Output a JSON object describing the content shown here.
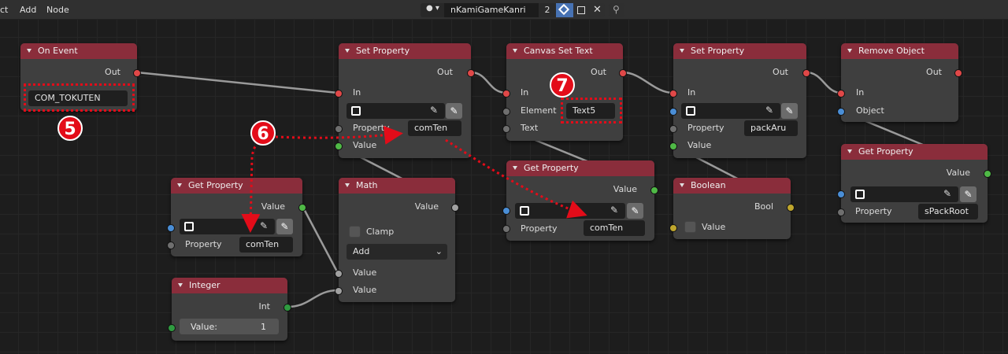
{
  "header": {
    "menu": [
      "ct",
      "Add",
      "Node"
    ],
    "tree_name": "nKamiGameKanri",
    "users": "2"
  },
  "nodes": {
    "on_event": {
      "title": "On Event",
      "out": "Out",
      "event": "COM_TOKUTEN"
    },
    "set_prop1": {
      "title": "Set Property",
      "out": "Out",
      "in": "In",
      "property_label": "Property",
      "property": "comTen",
      "value": "Value"
    },
    "canvas_text": {
      "title": "Canvas Set Text",
      "out": "Out",
      "in": "In",
      "element_label": "Element",
      "element": "Text5",
      "text": "Text"
    },
    "set_prop2": {
      "title": "Set Property",
      "out": "Out",
      "in": "In",
      "property_label": "Property",
      "property": "packAru",
      "value": "Value"
    },
    "remove_obj": {
      "title": "Remove Object",
      "out": "Out",
      "in": "In",
      "object": "Object"
    },
    "get_prop_right": {
      "title": "Get Property",
      "value": "Value",
      "property_label": "Property",
      "property": "sPackRoot"
    },
    "get_prop_left": {
      "title": "Get Property",
      "value": "Value",
      "property_label": "Property",
      "property": "comTen"
    },
    "math": {
      "title": "Math",
      "value": "Value",
      "clamp": "Clamp",
      "op": "Add",
      "in1": "Value",
      "in2": "Value"
    },
    "get_prop_mid": {
      "title": "Get Property",
      "value": "Value",
      "property_label": "Property",
      "property": "comTen"
    },
    "boolean": {
      "title": "Boolean",
      "bool": "Bool",
      "value": "Value"
    },
    "integer": {
      "title": "Integer",
      "int": "Int",
      "field_label": "Value:",
      "field_value": "1"
    }
  },
  "callouts": [
    "5",
    "6",
    "7"
  ],
  "colors": {
    "accent": "#e30c19",
    "header_red": "#8a2d3b"
  }
}
